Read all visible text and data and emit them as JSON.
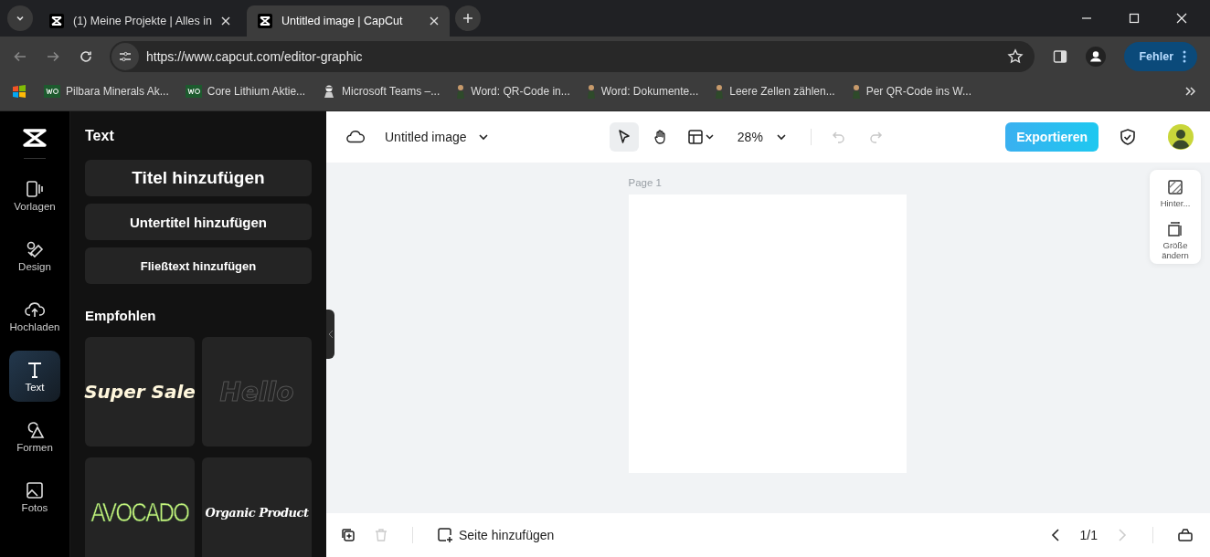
{
  "browser": {
    "tabs": [
      {
        "title": "(1)  Meine Projekte | Alles in",
        "selected": false
      },
      {
        "title": "Untitled image | CapCut",
        "selected": true
      }
    ],
    "url": "https://www.capcut.com/editor-graphic",
    "profile_button": "Fehler",
    "bookmarks": [
      {
        "label": "Pilbara Minerals Ak...",
        "kind": "wo"
      },
      {
        "label": "Core Lithium Aktie...",
        "kind": "wo"
      },
      {
        "label": "Microsoft Teams –...",
        "kind": "teams"
      },
      {
        "label": "Word: QR-Code in...",
        "kind": "person"
      },
      {
        "label": "Word: Dokumente...",
        "kind": "person"
      },
      {
        "label": "Leere Zellen zählen...",
        "kind": "person"
      },
      {
        "label": "Per QR-Code ins W...",
        "kind": "person"
      }
    ]
  },
  "sidebar": {
    "items": [
      {
        "label": "Vorlagen",
        "kind": "templates",
        "selected": false
      },
      {
        "label": "Design",
        "kind": "design",
        "selected": false
      },
      {
        "label": "Hochladen",
        "kind": "upload",
        "selected": false
      },
      {
        "label": "Text",
        "kind": "text",
        "selected": true
      },
      {
        "label": "Formen",
        "kind": "shapes",
        "selected": false
      },
      {
        "label": "Fotos",
        "kind": "photos",
        "selected": false
      }
    ]
  },
  "panel": {
    "title": "Text",
    "add_buttons": [
      {
        "label": "Titel hinzufügen",
        "kind": "title"
      },
      {
        "label": "Untertitel hinzufügen",
        "kind": "subtitle"
      },
      {
        "label": "Fließtext hinzufügen",
        "kind": "body"
      }
    ],
    "section": "Empfohlen",
    "presets": [
      {
        "text": "Super Sale",
        "kind": "sale"
      },
      {
        "text": "Hello",
        "kind": "outline"
      },
      {
        "text": "AVOCADO",
        "kind": "avocado"
      },
      {
        "text": "Organic Product",
        "kind": "script"
      }
    ]
  },
  "toolbar": {
    "doc_title": "Untitled image",
    "tools": [
      {
        "kind": "pointer",
        "selected": true
      },
      {
        "kind": "hand",
        "selected": false
      }
    ],
    "zoom": "28%",
    "history": [
      {
        "kind": "undo",
        "disabled": true
      },
      {
        "kind": "redo",
        "disabled": true
      }
    ],
    "export_button": "Exportieren"
  },
  "canvas": {
    "page_label": "Page 1"
  },
  "side_tools": [
    {
      "label": "Hinter...",
      "kind": "background"
    },
    {
      "label": "Größe ändern",
      "kind": "resize"
    }
  ],
  "bottom_bar": {
    "delete_disabled": true,
    "add_page": "Seite hinzufügen",
    "page_counter": "1/1",
    "prev_disabled": false,
    "next_disabled": true
  }
}
